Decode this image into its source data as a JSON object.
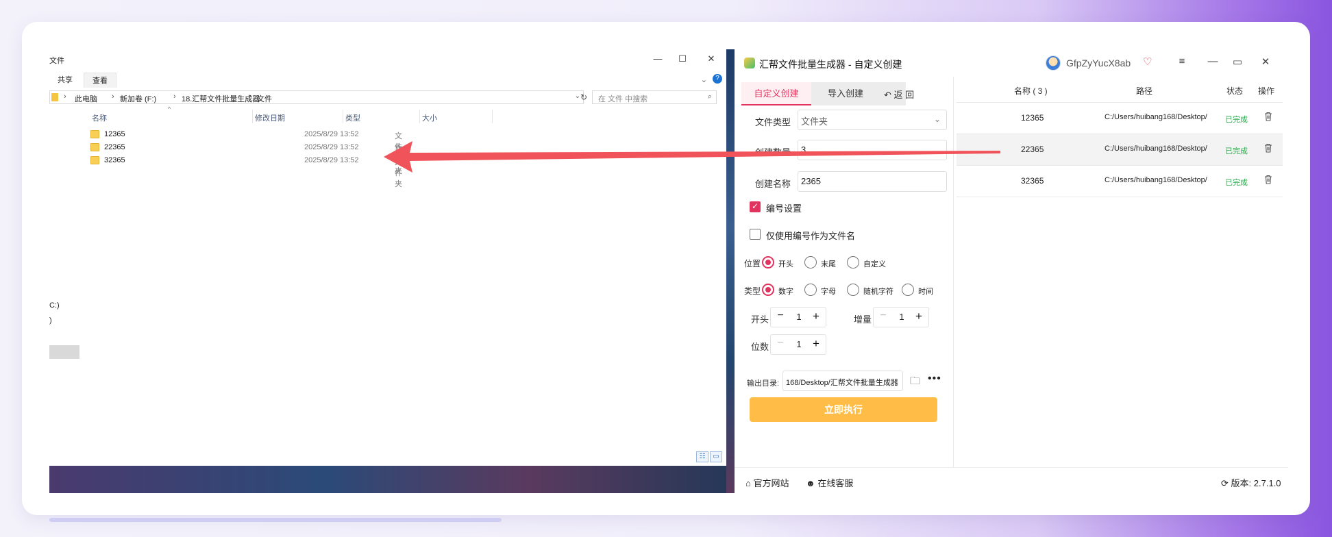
{
  "explorer": {
    "title": "文件",
    "ribbon_tabs": [
      "共享",
      "查看"
    ],
    "breadcrumb": [
      "此电脑",
      "新加卷 (F:)",
      "18.汇帮文件批量生成器",
      "文件"
    ],
    "search_placeholder": "在 文件 中搜索",
    "columns": [
      "名称",
      "修改日期",
      "类型",
      "大小"
    ],
    "files": [
      {
        "name": "12365",
        "date": "2025/8/29 13:52",
        "type": "文件夹"
      },
      {
        "name": "22365",
        "date": "2025/8/29 13:52",
        "type": "文件夹"
      },
      {
        "name": "32365",
        "date": "2025/8/29 13:52",
        "type": "文件夹"
      }
    ],
    "nav_fragments": [
      "C:)",
      ")"
    ]
  },
  "app": {
    "title": "汇帮文件批量生成器 - 自定义创建",
    "username": "GfpZyYucX8ab",
    "tabs": [
      "自定义创建",
      "导入创建"
    ],
    "back_label": "返  回",
    "file_type_label": "文件类型",
    "file_type_value": "文件夹",
    "count_label": "创建数量",
    "count_value": "3",
    "name_label": "创建名称",
    "name_value": "2365",
    "numbering_label": "编号设置",
    "numbering_checked": true,
    "only_number_label": "仅使用编号作为文件名",
    "only_number_checked": false,
    "position_label": "位置",
    "position_options": [
      "开头",
      "末尾",
      "自定义"
    ],
    "position_selected": "开头",
    "type_label": "类型",
    "type_options": [
      "数字",
      "字母",
      "随机字符",
      "时间"
    ],
    "type_selected": "数字",
    "start_label": "开头",
    "start_value": "1",
    "increment_label": "增量",
    "increment_value": "1",
    "digits_label": "位数",
    "digits_value": "1",
    "output_label": "输出目录:",
    "output_path": "168/Desktop/汇帮文件批量生成器",
    "run_label": "立即执行",
    "footer_site": "官方网站",
    "footer_service": "在线客服",
    "version_label": "版本:",
    "version": "2.7.1.0"
  },
  "table": {
    "headers": [
      "名称 ( 3 )",
      "路径",
      "状态",
      "操作"
    ],
    "rows": [
      {
        "name": "12365",
        "path": "C:/Users/huibang168/Desktop/",
        "status": "已完成"
      },
      {
        "name": "22365",
        "path": "C:/Users/huibang168/Desktop/",
        "status": "已完成"
      },
      {
        "name": "32365",
        "path": "C:/Users/huibang168/Desktop/",
        "status": "已完成"
      }
    ]
  },
  "colors": {
    "accent": "#e2335f",
    "run_button": "#ffbd48",
    "status_done": "#2fa84f",
    "arrow": "#f0545a"
  },
  "icons": [
    "minimize-icon",
    "maximize-icon",
    "close-icon",
    "help-icon",
    "folder-icon",
    "refresh-icon",
    "search-icon",
    "back-icon",
    "menu-icon",
    "vip-heart-icon",
    "trash-icon",
    "home-icon",
    "service-icon",
    "update-icon",
    "more-icon"
  ]
}
